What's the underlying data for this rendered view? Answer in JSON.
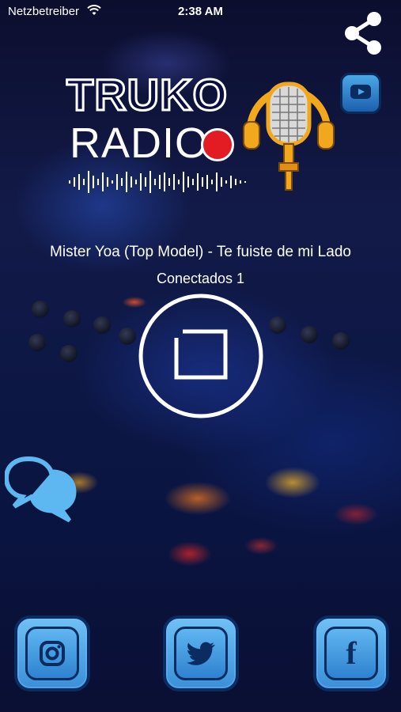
{
  "status_bar": {
    "carrier": "Netzbetreiber",
    "time": "2:38 AM"
  },
  "logo": {
    "line1": "TRUKO",
    "line2": "RADIO"
  },
  "now_playing": {
    "title": "Mister Yoa (Top Model) - Te fuiste de mi Lado",
    "listeners": "Conectados 1"
  },
  "icons": {
    "share": "share-icon",
    "youtube": "youtube-icon",
    "player": "stop-icon",
    "chat": "chat-icon",
    "instagram": "instagram-icon",
    "twitter": "twitter-icon",
    "facebook": "facebook-icon"
  },
  "colors": {
    "button_blue": "#4aa9e8",
    "button_border": "#0a2c60",
    "logo_red": "#e31b23",
    "mic_gold": "#f2a81d"
  }
}
